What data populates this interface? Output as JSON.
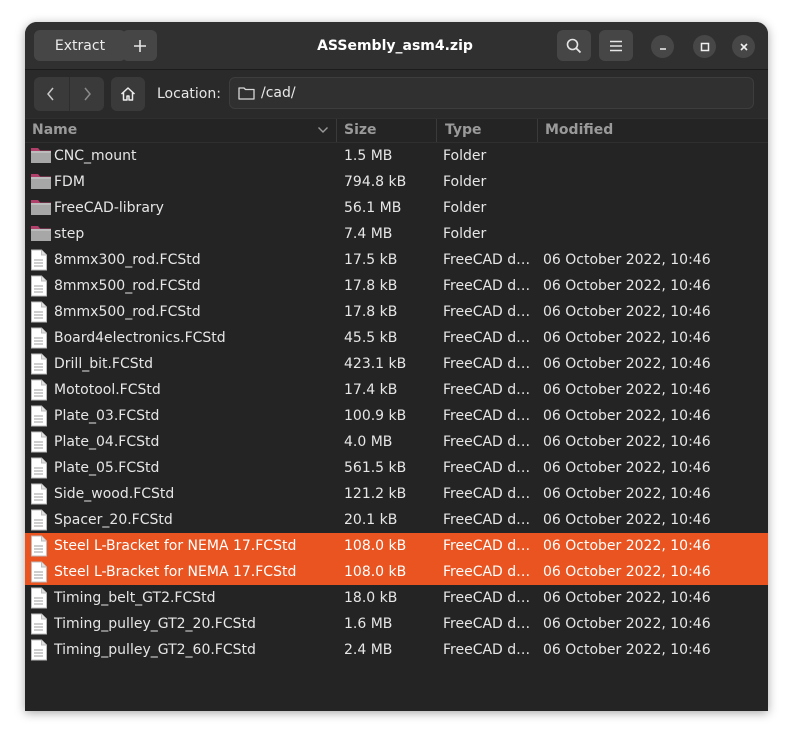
{
  "window": {
    "title": "ASSembly_asm4.zip",
    "extract_label": "Extract"
  },
  "toolbar": {
    "location_label": "Location:",
    "path": "/cad/"
  },
  "columns": {
    "name": "Name",
    "size": "Size",
    "type": "Type",
    "modified": "Modified"
  },
  "colors": {
    "accent": "#e95420",
    "folder": "#a0395e"
  },
  "files": [
    {
      "name": "CNC_mount",
      "size": "1.5 MB",
      "type": "Folder",
      "modified": "",
      "icon": "folder-icon",
      "selected": false
    },
    {
      "name": "FDM",
      "size": "794.8 kB",
      "type": "Folder",
      "modified": "",
      "icon": "folder-icon",
      "selected": false
    },
    {
      "name": "FreeCAD-library",
      "size": "56.1 MB",
      "type": "Folder",
      "modified": "",
      "icon": "folder-icon",
      "selected": false
    },
    {
      "name": "step",
      "size": "7.4 MB",
      "type": "Folder",
      "modified": "",
      "icon": "folder-icon",
      "selected": false
    },
    {
      "name": "8mmx300_rod.FCStd",
      "size": "17.5 kB",
      "type": "FreeCAD d…",
      "modified": "06 October 2022, 10:46",
      "icon": "document-icon",
      "selected": false
    },
    {
      "name": "8mmx500_rod.FCStd",
      "size": "17.8 kB",
      "type": "FreeCAD d…",
      "modified": "06 October 2022, 10:46",
      "icon": "document-icon",
      "selected": false
    },
    {
      "name": "8mmx500_rod.FCStd",
      "size": "17.8 kB",
      "type": "FreeCAD d…",
      "modified": "06 October 2022, 10:46",
      "icon": "document-icon",
      "selected": false
    },
    {
      "name": "Board4electronics.FCStd",
      "size": "45.5 kB",
      "type": "FreeCAD d…",
      "modified": "06 October 2022, 10:46",
      "icon": "document-icon",
      "selected": false
    },
    {
      "name": "Drill_bit.FCStd",
      "size": "423.1 kB",
      "type": "FreeCAD d…",
      "modified": "06 October 2022, 10:46",
      "icon": "document-icon",
      "selected": false
    },
    {
      "name": "Mototool.FCStd",
      "size": "17.4 kB",
      "type": "FreeCAD d…",
      "modified": "06 October 2022, 10:46",
      "icon": "document-icon",
      "selected": false
    },
    {
      "name": "Plate_03.FCStd",
      "size": "100.9 kB",
      "type": "FreeCAD d…",
      "modified": "06 October 2022, 10:46",
      "icon": "document-icon",
      "selected": false
    },
    {
      "name": "Plate_04.FCStd",
      "size": "4.0 MB",
      "type": "FreeCAD d…",
      "modified": "06 October 2022, 10:46",
      "icon": "document-icon",
      "selected": false
    },
    {
      "name": "Plate_05.FCStd",
      "size": "561.5 kB",
      "type": "FreeCAD d…",
      "modified": "06 October 2022, 10:46",
      "icon": "document-icon",
      "selected": false
    },
    {
      "name": "Side_wood.FCStd",
      "size": "121.2 kB",
      "type": "FreeCAD d…",
      "modified": "06 October 2022, 10:46",
      "icon": "document-icon",
      "selected": false
    },
    {
      "name": "Spacer_20.FCStd",
      "size": "20.1 kB",
      "type": "FreeCAD d…",
      "modified": "06 October 2022, 10:46",
      "icon": "document-icon",
      "selected": false
    },
    {
      "name": "Steel L-Bracket for NEMA 17.FCStd",
      "size": "108.0 kB",
      "type": "FreeCAD d…",
      "modified": "06 October 2022, 10:46",
      "icon": "document-icon",
      "selected": true
    },
    {
      "name": "Steel L-Bracket for NEMA 17.FCStd",
      "size": "108.0 kB",
      "type": "FreeCAD d…",
      "modified": "06 October 2022, 10:46",
      "icon": "document-icon",
      "selected": true
    },
    {
      "name": "Timing_belt_GT2.FCStd",
      "size": "18.0 kB",
      "type": "FreeCAD d…",
      "modified": "06 October 2022, 10:46",
      "icon": "document-icon",
      "selected": false
    },
    {
      "name": "Timing_pulley_GT2_20.FCStd",
      "size": "1.6 MB",
      "type": "FreeCAD d…",
      "modified": "06 October 2022, 10:46",
      "icon": "document-icon",
      "selected": false
    },
    {
      "name": "Timing_pulley_GT2_60.FCStd",
      "size": "2.4 MB",
      "type": "FreeCAD d…",
      "modified": "06 October 2022, 10:46",
      "icon": "document-icon",
      "selected": false
    }
  ]
}
